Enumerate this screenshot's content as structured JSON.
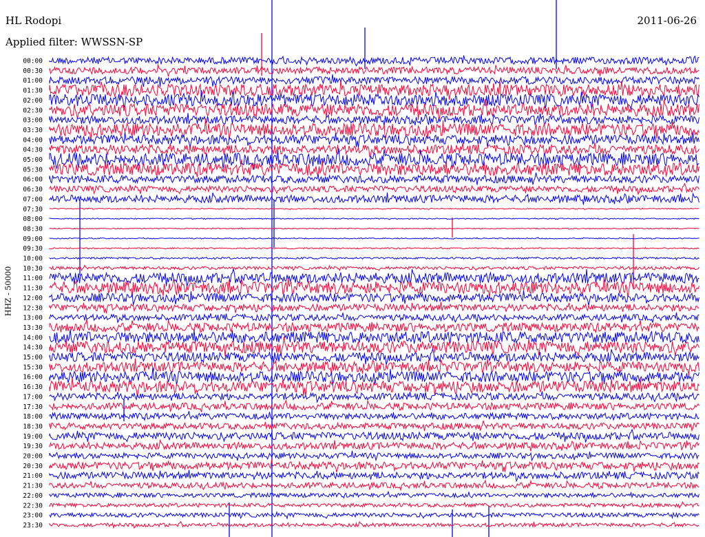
{
  "header": {
    "station": "HL Rodopi",
    "filter": "Applied filter: WWSSN-SP",
    "date": "2011-06-26",
    "channel": "HHZ - 50000"
  },
  "chart_data": {
    "type": "line",
    "title": "HL Rodopi",
    "date": "2011-06-26",
    "filter": "WWSSN-SP",
    "ylabel": "HHZ - 50000",
    "colors": [
      "#0000ff",
      "#ff0033"
    ],
    "grid": false,
    "rows": [
      {
        "time": "00:00",
        "amp": 0.55,
        "color": "#0000ff"
      },
      {
        "time": "00:30",
        "amp": 0.55,
        "color": "#ff0033"
      },
      {
        "time": "01:00",
        "amp": 0.6,
        "color": "#0000ff"
      },
      {
        "time": "01:30",
        "amp": 0.95,
        "color": "#ff0033"
      },
      {
        "time": "02:00",
        "amp": 0.95,
        "color": "#0000ff"
      },
      {
        "time": "02:30",
        "amp": 1.0,
        "color": "#ff0033"
      },
      {
        "time": "03:00",
        "amp": 0.65,
        "color": "#0000ff"
      },
      {
        "time": "03:30",
        "amp": 1.0,
        "color": "#ff0033"
      },
      {
        "time": "04:00",
        "amp": 0.75,
        "color": "#0000ff"
      },
      {
        "time": "04:30",
        "amp": 0.75,
        "color": "#ff0033"
      },
      {
        "time": "05:00",
        "amp": 1.0,
        "color": "#0000ff"
      },
      {
        "time": "05:30",
        "amp": 1.0,
        "color": "#ff0033"
      },
      {
        "time": "06:00",
        "amp": 0.6,
        "color": "#0000ff"
      },
      {
        "time": "06:30",
        "amp": 0.5,
        "color": "#ff0033"
      },
      {
        "time": "07:00",
        "amp": 0.6,
        "color": "#0000ff"
      },
      {
        "time": "07:30",
        "amp": 0.08,
        "color": "#ff0033"
      },
      {
        "time": "08:00",
        "amp": 0.08,
        "color": "#0000ff"
      },
      {
        "time": "08:30",
        "amp": 0.08,
        "color": "#ff0033"
      },
      {
        "time": "09:00",
        "amp": 0.08,
        "color": "#0000ff"
      },
      {
        "time": "09:30",
        "amp": 0.1,
        "color": "#ff0033"
      },
      {
        "time": "10:00",
        "amp": 0.15,
        "color": "#0000ff"
      },
      {
        "time": "10:30",
        "amp": 0.25,
        "color": "#ff0033"
      },
      {
        "time": "11:00",
        "amp": 0.85,
        "color": "#0000ff"
      },
      {
        "time": "11:30",
        "amp": 0.95,
        "color": "#ff0033"
      },
      {
        "time": "12:00",
        "amp": 0.7,
        "color": "#0000ff"
      },
      {
        "time": "12:30",
        "amp": 0.55,
        "color": "#ff0033"
      },
      {
        "time": "13:00",
        "amp": 0.5,
        "color": "#0000ff"
      },
      {
        "time": "13:30",
        "amp": 0.7,
        "color": "#ff0033"
      },
      {
        "time": "14:00",
        "amp": 0.9,
        "color": "#0000ff"
      },
      {
        "time": "14:30",
        "amp": 0.95,
        "color": "#ff0033"
      },
      {
        "time": "15:00",
        "amp": 0.75,
        "color": "#0000ff"
      },
      {
        "time": "15:30",
        "amp": 0.8,
        "color": "#ff0033"
      },
      {
        "time": "16:00",
        "amp": 0.85,
        "color": "#0000ff"
      },
      {
        "time": "16:30",
        "amp": 0.9,
        "color": "#ff0033"
      },
      {
        "time": "17:00",
        "amp": 0.55,
        "color": "#0000ff"
      },
      {
        "time": "17:30",
        "amp": 0.55,
        "color": "#ff0033"
      },
      {
        "time": "18:00",
        "amp": 0.5,
        "color": "#0000ff"
      },
      {
        "time": "18:30",
        "amp": 0.5,
        "color": "#ff0033"
      },
      {
        "time": "19:00",
        "amp": 0.6,
        "color": "#0000ff"
      },
      {
        "time": "19:30",
        "amp": 0.55,
        "color": "#ff0033"
      },
      {
        "time": "20:00",
        "amp": 0.45,
        "color": "#0000ff"
      },
      {
        "time": "20:30",
        "amp": 0.6,
        "color": "#ff0033"
      },
      {
        "time": "21:00",
        "amp": 0.55,
        "color": "#0000ff"
      },
      {
        "time": "21:30",
        "amp": 0.45,
        "color": "#ff0033"
      },
      {
        "time": "22:00",
        "amp": 0.35,
        "color": "#0000ff"
      },
      {
        "time": "22:30",
        "amp": 0.3,
        "color": "#ff0033"
      },
      {
        "time": "23:00",
        "amp": 0.35,
        "color": "#0000ff"
      },
      {
        "time": "23:30",
        "amp": 0.3,
        "color": "#ff0033"
      }
    ]
  }
}
